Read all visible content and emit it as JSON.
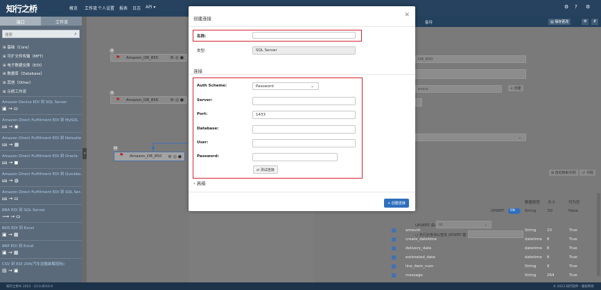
{
  "topbar": {
    "brand": "知行之桥",
    "nav": [
      "概览",
      "工作流",
      "个人设置",
      "报表",
      "日志",
      "API"
    ],
    "nav_api_arrow": "▾",
    "right_icons": [
      "gear-icon",
      "help-icon",
      "user-icon"
    ]
  },
  "left": {
    "tabs": [
      "端口",
      "工作流"
    ],
    "search_placeholder": "搜索",
    "categories": [
      "⊞ 基础（Core）",
      "⊞ 可扩文件传输（MFT）",
      "⊞ 电子数据交换（EDI）",
      "⊞ 数据库（Database）",
      "⊞ 其他（Other）",
      "⊞ 示例工作流"
    ],
    "connectors": [
      {
        "title": "Amazon Device EDI 到 SQL Server",
        "icons": "▣ → ⛀"
      },
      {
        "title": "Amazon Direct Fulfillment EDI 到 MySQL",
        "icons": "⅏ → ◉"
      },
      {
        "title": "Amazon Direct Fulfillment EDI 到 Netsuite",
        "icons": "⅏ → ▦"
      },
      {
        "title": "Amazon Direct Fulfillment EDI 到 Oracle",
        "icons": "⅏ → ◼"
      },
      {
        "title": "Amazon Direct Fulfillment EDI 到 Quickbo...",
        "icons": "⅏ → ◍"
      },
      {
        "title": "Amazon Direct Fulfillment EDI 到 SQL Ser...",
        "icons": "⅏ → ⛀"
      },
      {
        "title": "BBA EDI 到 SQL Server",
        "icons": "⟿ → ⛀"
      },
      {
        "title": "BOS EDI 到 Excel",
        "icons": "▣ → ▦"
      },
      {
        "title": "BRP EDI 到 Excel",
        "icons": "▣ → ▦"
      },
      {
        "title": "CSV 到 EDI 204(汽车运输装载招标)",
        "icons": "▤ → ▣"
      }
    ]
  },
  "canvas": {
    "nodes": [
      {
        "num": "8",
        "label": "Amazon_DB_855"
      },
      {
        "num": "9",
        "label": "Amazon_DB_856"
      },
      {
        "num": "10",
        "label": "Amazon_DB_850"
      }
    ]
  },
  "right": {
    "tab": "备待",
    "buttons": [
      "▤ 保存更改",
      "⚙",
      "⇵"
    ],
    "field_value": "DB_850",
    "select_value": "evice",
    "add_button": "+ 创建",
    "toolbar_buttons": [
      "⊞ 自动映射示例",
      "‹/› 代码"
    ],
    "columns": [
      "数据类型",
      "大小",
      "可为空"
    ],
    "upsert_label": "UPSERT",
    "upsert_toggle": "ON",
    "upsert_type": "String",
    "upsert_size": "50",
    "upsert_nullable": "False",
    "upsert_by": "UPSERT 由:",
    "upsert_by_value": "id",
    "upsert_query_label": "执行此查询以查找 UPSERT 键:",
    "rows": [
      {
        "name": "amount",
        "type": "String",
        "size": "10",
        "nullable": "True"
      },
      {
        "name": "create_datetime",
        "type": "datetime",
        "size": "8",
        "nullable": "True"
      },
      {
        "name": "delivery_date",
        "type": "datetime",
        "size": "8",
        "nullable": "True"
      },
      {
        "name": "estimated_date",
        "type": "datetime",
        "size": "8",
        "nullable": "True"
      },
      {
        "name": "line_item_num",
        "type": "String",
        "size": "9",
        "nullable": "True"
      },
      {
        "name": "message",
        "type": "String",
        "size": "264",
        "nullable": "True"
      }
    ]
  },
  "modal": {
    "title": "创建连接",
    "name_label": "名称:",
    "name_value": "",
    "type_label": "类型:",
    "type_value": "SQL Server",
    "section_connection": "连接",
    "auth_label": "Auth Scheme:",
    "auth_value": "Password",
    "server_label": "Server:",
    "server_value": "",
    "port_label": "Port:",
    "port_value": "1433",
    "database_label": "Database:",
    "database_value": "",
    "user_label": "User:",
    "user_value": "",
    "password_label": "Password:",
    "password_value": "",
    "test_button": "⇄ 测试连接",
    "advanced": "高级",
    "create_button": "+ 创建连接"
  },
  "footer": {
    "left": "知行之桥® 2023 - 23.0.8510.0",
    "right": "© 2023 知行软件 - 版权所有"
  }
}
